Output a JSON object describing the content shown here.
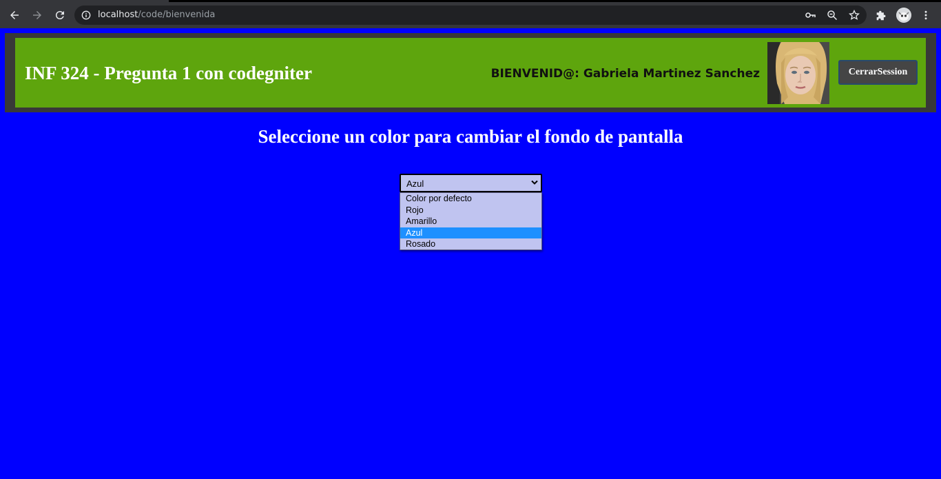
{
  "browser": {
    "url_host": "localhost",
    "url_path": "/code/bienvenida"
  },
  "header": {
    "title": "INF 324 - Pregunta 1 con codegniter",
    "welcome_text": "BIENVENID@: Gabriela Martinez Sanchez",
    "logout_label": "CerrarSession"
  },
  "main": {
    "heading": "Seleccione un color para cambiar el fondo de pantalla",
    "select": {
      "selected": "Azul",
      "options": [
        "Color por defecto",
        "Rojo",
        "Amarillo",
        "Azul",
        "Rosado"
      ]
    }
  },
  "colors": {
    "page_background": "#0000ff",
    "header_bar": "#5ea50d",
    "header_border": "#383838",
    "option_highlight": "#1e90ff"
  }
}
